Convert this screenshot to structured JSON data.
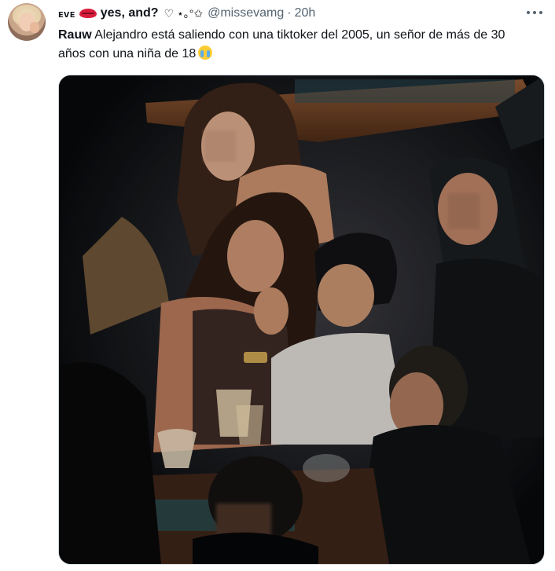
{
  "tweet": {
    "author": {
      "name_prefix": "ᴇᴠᴇ",
      "lips_icon": "kiss-lips-icon",
      "name_main": "yes, and?",
      "name_suffix": "♡ ⋆｡°✩",
      "handle": "@missevamg",
      "separator": "·",
      "time": "20h"
    },
    "text": {
      "bold_word": "Rauw",
      "body": " Alejandro está saliendo con una tiktoker del 2005, un señor de más de 30 años con una niña de 18",
      "emoji": "loudly-crying-face-icon"
    },
    "more_icon": "more-horizontal-icon",
    "media": {
      "kind": "photo",
      "description_icon": "photo-icon",
      "colors": {
        "background": "#0a0d10",
        "table_wood": "#7a4a2a",
        "skin": "#c98e6e",
        "white_shirt": "#d8d4d0"
      }
    }
  }
}
